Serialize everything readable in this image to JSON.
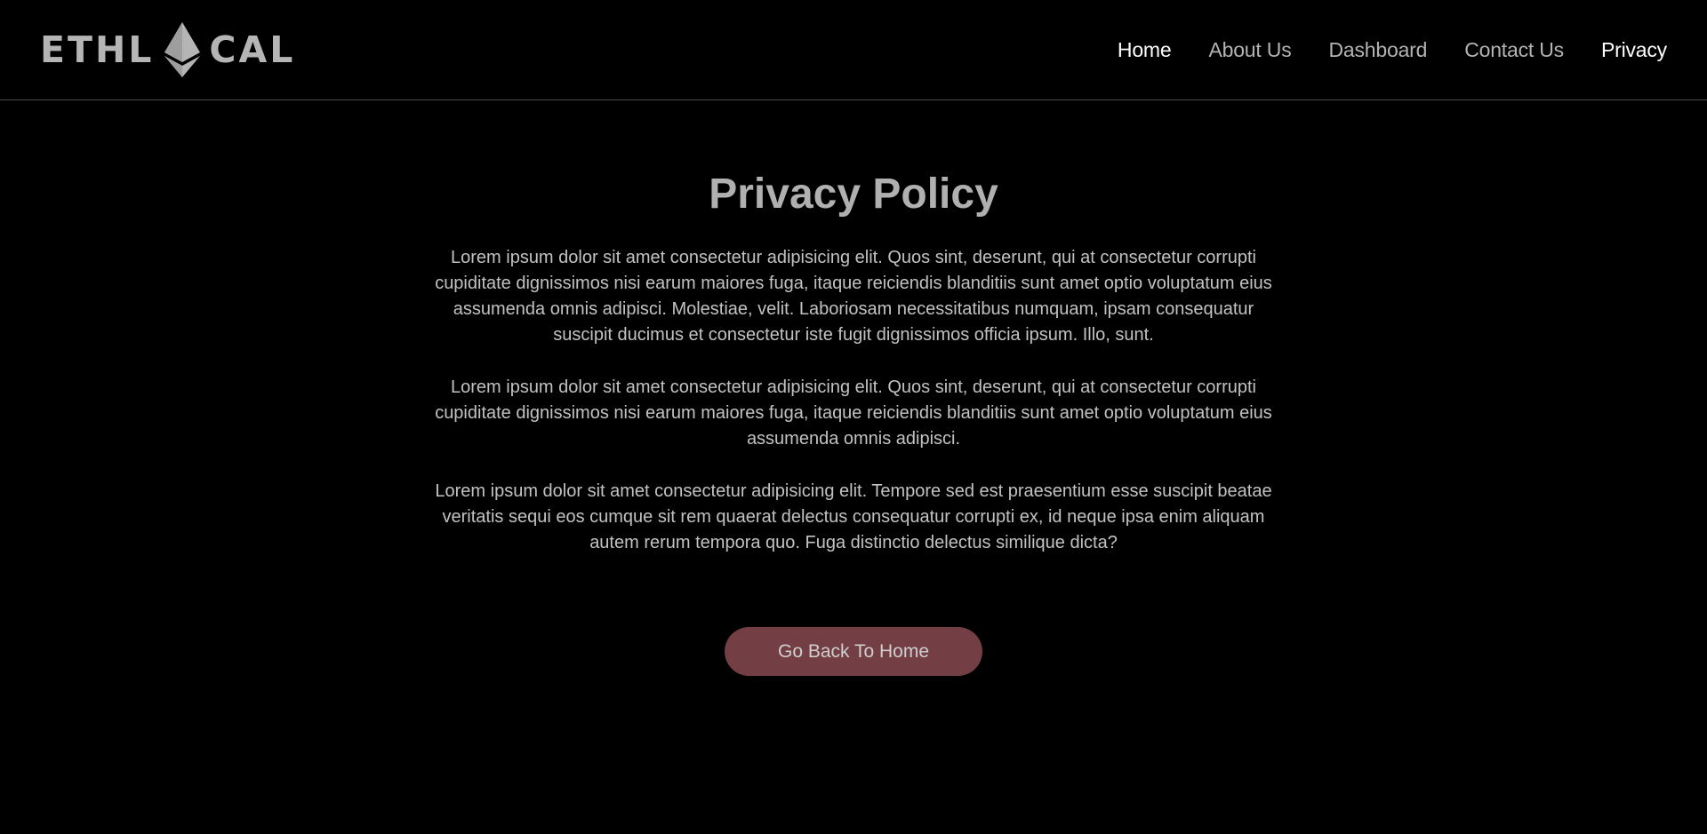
{
  "header": {
    "logo": {
      "left_text": "ETHL",
      "right_text": "CAL",
      "icon": "ethereum-diamond-icon"
    },
    "nav": [
      {
        "label": "Home",
        "active": true
      },
      {
        "label": "About Us",
        "active": false
      },
      {
        "label": "Dashboard",
        "active": false
      },
      {
        "label": "Contact Us",
        "active": false
      },
      {
        "label": "Privacy",
        "active": true
      }
    ]
  },
  "main": {
    "title": "Privacy Policy",
    "paragraphs": [
      "Lorem ipsum dolor sit amet consectetur adipisicing elit. Quos sint, deserunt, qui at consectetur corrupti cupiditate dignissimos nisi earum maiores fuga, itaque reiciendis blanditiis sunt amet optio voluptatum eius assumenda omnis adipisci. Molestiae, velit. Laboriosam necessitatibus numquam, ipsam consequatur suscipit ducimus et consectetur iste fugit dignissimos officia ipsum. Illo, sunt.",
      "Lorem ipsum dolor sit amet consectetur adipisicing elit. Quos sint, deserunt, qui at consectetur corrupti cupiditate dignissimos nisi earum maiores fuga, itaque reiciendis blanditiis sunt amet optio voluptatum eius assumenda omnis adipisci.",
      "Lorem ipsum dolor sit amet consectetur adipisicing elit. Tempore sed est praesentium esse suscipit beatae veritatis sequi eos cumque sit rem quaerat delectus consequatur corrupti ex, id neque ipsa enim aliquam autem rerum tempora quo. Fuga distinctio delectus similique dicta?"
    ],
    "back_button_label": "Go Back To Home"
  },
  "colors": {
    "background": "#000000",
    "nav_active": "#ffffff",
    "nav_inactive": "#b3b3b3",
    "button_bg": "#733e44"
  }
}
